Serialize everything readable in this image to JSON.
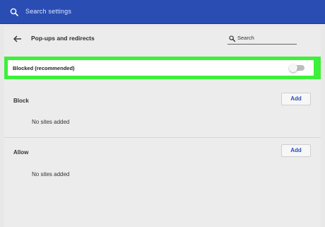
{
  "topbar": {
    "search_placeholder": "Search settings",
    "icon": "search-icon",
    "bg_color": "#2a4db4"
  },
  "header": {
    "back_icon": "back-arrow-icon",
    "title": "Pop-ups and redirects",
    "search_placeholder": "Search"
  },
  "blocked_setting": {
    "label": "Blocked (recommended)",
    "toggle_on": false,
    "highlight_color": "#3df03a"
  },
  "sections": {
    "block": {
      "label": "Block",
      "add_label": "Add",
      "empty_text": "No sites added"
    },
    "allow": {
      "label": "Allow",
      "add_label": "Add",
      "empty_text": "No sites added"
    }
  }
}
